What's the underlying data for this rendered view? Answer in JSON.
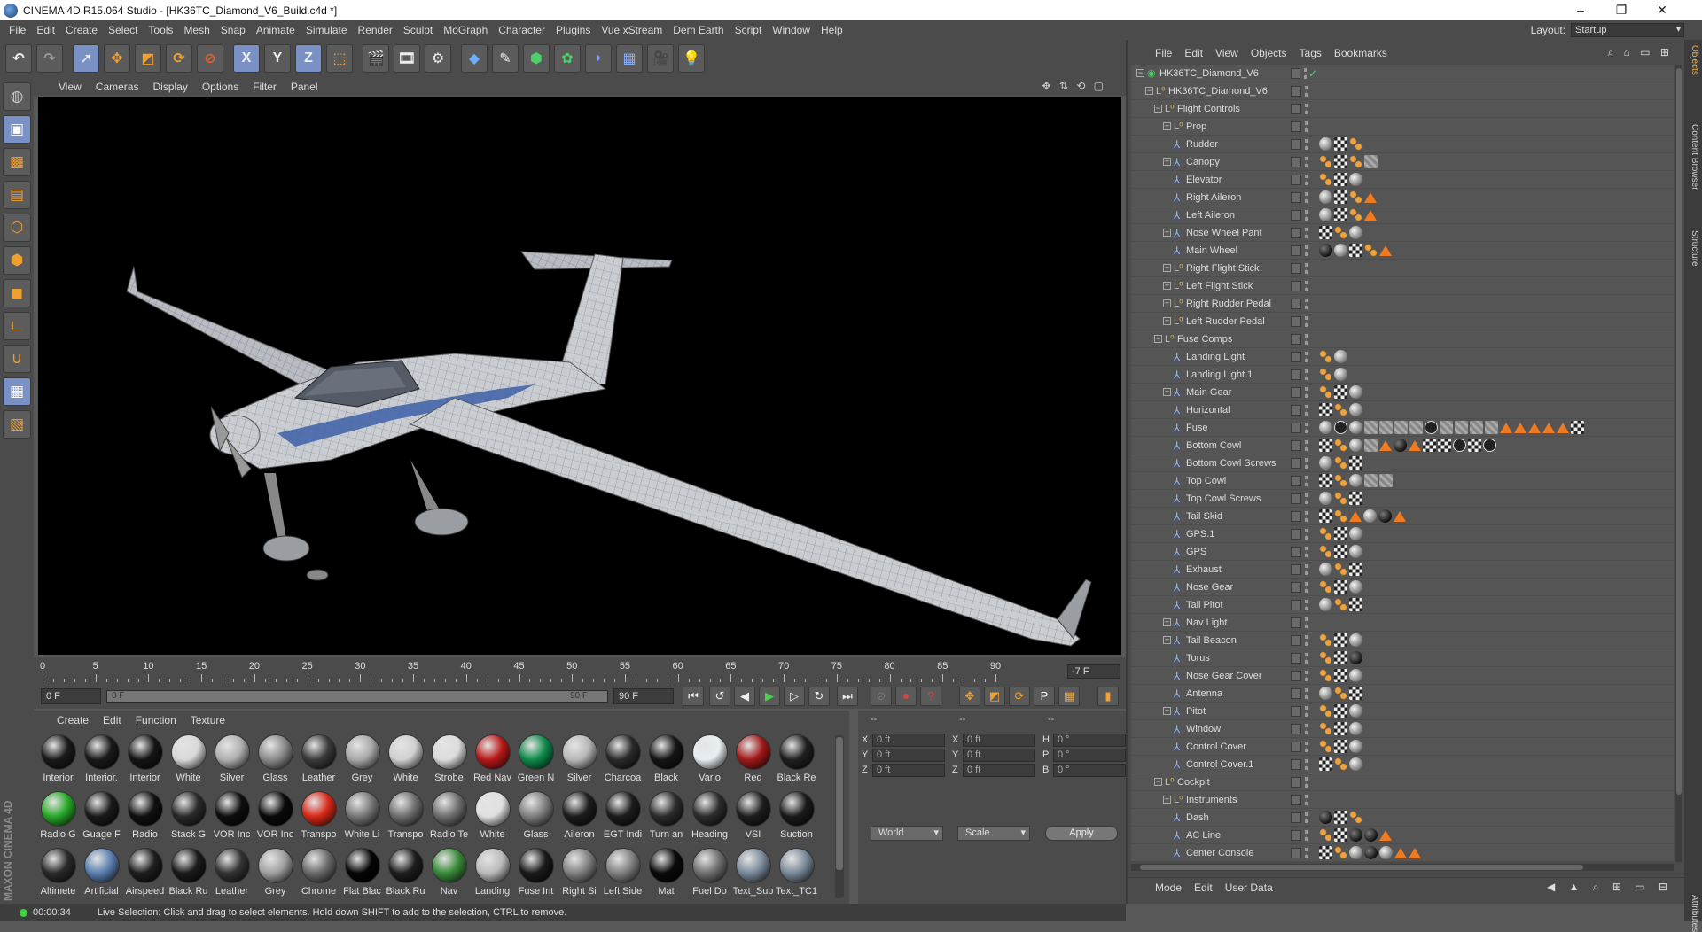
{
  "window": {
    "title": "CINEMA 4D R15.064 Studio - [HK36TC_Diamond_V6_Build.c4d *]",
    "minimize": "–",
    "maximize": "❐",
    "close": "✕"
  },
  "menubar": [
    "File",
    "Edit",
    "Create",
    "Select",
    "Tools",
    "Mesh",
    "Snap",
    "Animate",
    "Simulate",
    "Render",
    "Sculpt",
    "MoGraph",
    "Character",
    "Plugins",
    "Vue xStream",
    "Dem Earth",
    "Script",
    "Window",
    "Help"
  ],
  "layout": {
    "label": "Layout:",
    "value": "Startup"
  },
  "toolbar_axis": {
    "x": "X",
    "y": "Y",
    "z": "Z"
  },
  "viewport_menu": [
    "View",
    "Cameras",
    "Display",
    "Options",
    "Filter",
    "Panel"
  ],
  "timeline": {
    "ticks": [
      "0",
      "5",
      "10",
      "15",
      "20",
      "25",
      "30",
      "35",
      "40",
      "45",
      "50",
      "55",
      "60",
      "65",
      "70",
      "75",
      "80",
      "85",
      "90"
    ],
    "current_frame": "-7 F"
  },
  "transport": {
    "start": "0 F",
    "range_start": "0 F",
    "range_end": "90 F",
    "end": "90 F"
  },
  "materials": {
    "menu": [
      "Create",
      "Edit",
      "Function",
      "Texture"
    ],
    "items": [
      {
        "label": "Interior",
        "color": "#1a1a1a"
      },
      {
        "label": "Interior.",
        "color": "#1a1a1a"
      },
      {
        "label": "Interior",
        "color": "#151515"
      },
      {
        "label": "White",
        "color": "#d8d8d8"
      },
      {
        "label": "Silver",
        "color": "#b0b0b0"
      },
      {
        "label": "Glass",
        "color": "#8a8a8a"
      },
      {
        "label": "Leather",
        "color": "#3a3a3a"
      },
      {
        "label": "Grey",
        "color": "#a8a8a8"
      },
      {
        "label": "White",
        "color": "#d0d0d0"
      },
      {
        "label": "Strobe",
        "color": "#dcdcdc"
      },
      {
        "label": "Red Nav",
        "color": "#b81818"
      },
      {
        "label": "Green N",
        "color": "#0d8a4a"
      },
      {
        "label": "Silver",
        "color": "#b8b8b8"
      },
      {
        "label": "Charcoa",
        "color": "#2a2a2a"
      },
      {
        "label": "Black",
        "color": "#151515"
      },
      {
        "label": "Vario",
        "color": "#e8eef2"
      },
      {
        "label": "Red",
        "color": "#a01818"
      },
      {
        "label": "Black Re",
        "color": "#202020"
      },
      {
        "label": "Radio G",
        "color": "#28a828"
      },
      {
        "label": "Guage F",
        "color": "#1a1a1a"
      },
      {
        "label": "Radio",
        "color": "#101010"
      },
      {
        "label": "Stack G",
        "color": "#2a2a2a"
      },
      {
        "label": "VOR Inc",
        "color": "#0e0e0e"
      },
      {
        "label": "VOR Inc",
        "color": "#0a0a0a"
      },
      {
        "label": "Transpo",
        "color": "#d82818"
      },
      {
        "label": "White Li",
        "color": "#777777"
      },
      {
        "label": "Transpo",
        "color": "#6e6e6e"
      },
      {
        "label": "Radio Te",
        "color": "#6e6e6e"
      },
      {
        "label": "White",
        "color": "#e0e0e0"
      },
      {
        "label": "Glass",
        "color": "#7e7e7e"
      },
      {
        "label": "Aileron",
        "color": "#1c1c1c"
      },
      {
        "label": "EGT Indi",
        "color": "#1c1c1c"
      },
      {
        "label": "Turn an",
        "color": "#2c2c2c"
      },
      {
        "label": "Heading",
        "color": "#2c2c2c"
      },
      {
        "label": "VSI",
        "color": "#1e1e1e"
      },
      {
        "label": "Suction",
        "color": "#1a1a1a"
      },
      {
        "label": "Altimete",
        "color": "#2a2a2a"
      },
      {
        "label": "Artificial",
        "color": "#5a7fb0"
      },
      {
        "label": "Airspeed",
        "color": "#1e1e1e"
      },
      {
        "label": "Black Ru",
        "color": "#1a1a1a"
      },
      {
        "label": "Leather",
        "color": "#333333"
      },
      {
        "label": "Grey",
        "color": "#a0a0a0"
      },
      {
        "label": "Chrome",
        "color": "#6a6a6a"
      },
      {
        "label": "Flat Blac",
        "color": "#050505"
      },
      {
        "label": "Black Ru",
        "color": "#1e1e1e"
      },
      {
        "label": "Nav",
        "color": "#3a8a3a"
      },
      {
        "label": "Landing",
        "color": "#bbbbbb"
      },
      {
        "label": "Fuse Int",
        "color": "#1a1a1a"
      },
      {
        "label": "Right Si",
        "color": "#808080"
      },
      {
        "label": "Left Side",
        "color": "#808080"
      },
      {
        "label": "Mat",
        "color": "#0a0a0a"
      },
      {
        "label": "Fuel Do",
        "color": "#707070"
      },
      {
        "label": "Text_Sup",
        "color": "#7a8a9a"
      },
      {
        "label": "Text_TC1",
        "color": "#7a8a9a"
      }
    ]
  },
  "coordinates": {
    "headers": [
      "--",
      "--",
      "--"
    ],
    "rows": [
      {
        "a": "X",
        "av": "0 ft",
        "b": "X",
        "bv": "0 ft",
        "c": "H",
        "cv": "0 °"
      },
      {
        "a": "Y",
        "av": "0 ft",
        "b": "Y",
        "bv": "0 ft",
        "c": "P",
        "cv": "0 °"
      },
      {
        "a": "Z",
        "av": "0 ft",
        "b": "Z",
        "bv": "0 ft",
        "c": "B",
        "cv": "0 °"
      }
    ],
    "space": "World",
    "mode": "Scale",
    "apply": "Apply"
  },
  "status": {
    "time": "00:00:34",
    "message": "Live Selection: Click and drag to select elements. Hold down SHIFT to add to the selection, CTRL to remove."
  },
  "object_manager": {
    "menu": [
      "File",
      "Edit",
      "View",
      "Objects",
      "Tags",
      "Bookmarks"
    ],
    "objects": [
      {
        "name": "HK36TC_Diamond_V6",
        "depth": 0,
        "expand": "-",
        "icon": "scene",
        "tags": "k"
      },
      {
        "name": "HK36TC_Diamond_V6",
        "depth": 1,
        "expand": "-",
        "icon": "null",
        "tags": ""
      },
      {
        "name": "Flight Controls",
        "depth": 2,
        "expand": "-",
        "icon": "null",
        "tags": ""
      },
      {
        "name": "Prop",
        "depth": 3,
        "expand": "+",
        "icon": "null",
        "tags": ""
      },
      {
        "name": "Rudder",
        "depth": 3,
        "expand": "",
        "icon": "joint",
        "tags": "s c o"
      },
      {
        "name": "Canopy",
        "depth": 3,
        "expand": "+",
        "icon": "joint",
        "tags": "o c o h"
      },
      {
        "name": "Elevator",
        "depth": 3,
        "expand": "",
        "icon": "joint",
        "tags": "o c s"
      },
      {
        "name": "Right Aileron",
        "depth": 3,
        "expand": "",
        "icon": "joint",
        "tags": "s c o t"
      },
      {
        "name": "Left Aileron",
        "depth": 3,
        "expand": "",
        "icon": "joint",
        "tags": "s c o t"
      },
      {
        "name": "Nose Wheel Pant",
        "depth": 3,
        "expand": "+",
        "icon": "joint",
        "tags": "c o s"
      },
      {
        "name": "Main Wheel",
        "depth": 3,
        "expand": "",
        "icon": "joint",
        "tags": "d s c o t"
      },
      {
        "name": "Right Flight Stick",
        "depth": 3,
        "expand": "+",
        "icon": "null",
        "tags": ""
      },
      {
        "name": "Left Flight Stick",
        "depth": 3,
        "expand": "+",
        "icon": "null",
        "tags": ""
      },
      {
        "name": "Right Rudder Pedal",
        "depth": 3,
        "expand": "+",
        "icon": "null",
        "tags": ""
      },
      {
        "name": "Left Rudder Pedal",
        "depth": 3,
        "expand": "+",
        "icon": "null",
        "tags": ""
      },
      {
        "name": "Fuse Comps",
        "depth": 2,
        "expand": "-",
        "icon": "null",
        "tags": ""
      },
      {
        "name": "Landing Light",
        "depth": 3,
        "expand": "",
        "icon": "joint",
        "tags": "o s"
      },
      {
        "name": "Landing Light.1",
        "depth": 3,
        "expand": "",
        "icon": "joint",
        "tags": "o s"
      },
      {
        "name": "Main Gear",
        "depth": 3,
        "expand": "+",
        "icon": "joint",
        "tags": "o c s"
      },
      {
        "name": "Horizontal",
        "depth": 3,
        "expand": "",
        "icon": "joint",
        "tags": "c o s"
      },
      {
        "name": "Fuse",
        "depth": 3,
        "expand": "",
        "icon": "joint",
        "tags": "s m s h h h h m h h h h t t t t t c"
      },
      {
        "name": "Bottom Cowl",
        "depth": 3,
        "expand": "",
        "icon": "joint",
        "tags": "c o s h t d t c c m c m"
      },
      {
        "name": "Bottom Cowl Screws",
        "depth": 3,
        "expand": "",
        "icon": "joint",
        "tags": "s o c"
      },
      {
        "name": "Top Cowl",
        "depth": 3,
        "expand": "",
        "icon": "joint",
        "tags": "c o s h h"
      },
      {
        "name": "Top Cowl Screws",
        "depth": 3,
        "expand": "",
        "icon": "joint",
        "tags": "s o c"
      },
      {
        "name": "Tail Skid",
        "depth": 3,
        "expand": "",
        "icon": "joint",
        "tags": "c o t s d t"
      },
      {
        "name": "GPS.1",
        "depth": 3,
        "expand": "",
        "icon": "joint",
        "tags": "o c s"
      },
      {
        "name": "GPS",
        "depth": 3,
        "expand": "",
        "icon": "joint",
        "tags": "o c s"
      },
      {
        "name": "Exhaust",
        "depth": 3,
        "expand": "",
        "icon": "joint",
        "tags": "s o c"
      },
      {
        "name": "Nose Gear",
        "depth": 3,
        "expand": "",
        "icon": "joint",
        "tags": "o c s"
      },
      {
        "name": "Tail Pitot",
        "depth": 3,
        "expand": "",
        "icon": "joint",
        "tags": "s o c"
      },
      {
        "name": "Nav Light",
        "depth": 3,
        "expand": "+",
        "icon": "joint",
        "tags": ""
      },
      {
        "name": "Tail Beacon",
        "depth": 3,
        "expand": "+",
        "icon": "joint",
        "tags": "o c s"
      },
      {
        "name": "Torus",
        "depth": 3,
        "expand": "",
        "icon": "joint",
        "tags": "o c d"
      },
      {
        "name": "Nose Gear Cover",
        "depth": 3,
        "expand": "",
        "icon": "joint",
        "tags": "o c s"
      },
      {
        "name": "Antenna",
        "depth": 3,
        "expand": "",
        "icon": "joint",
        "tags": "s o c"
      },
      {
        "name": "Pitot",
        "depth": 3,
        "expand": "+",
        "icon": "joint",
        "tags": "o c s"
      },
      {
        "name": "Window",
        "depth": 3,
        "expand": "",
        "icon": "joint",
        "tags": "o c s"
      },
      {
        "name": "Control Cover",
        "depth": 3,
        "expand": "",
        "icon": "joint",
        "tags": "o c s"
      },
      {
        "name": "Control Cover.1",
        "depth": 3,
        "expand": "",
        "icon": "joint",
        "tags": "c o s"
      },
      {
        "name": "Cockpit",
        "depth": 2,
        "expand": "-",
        "icon": "null",
        "tags": ""
      },
      {
        "name": "Instruments",
        "depth": 3,
        "expand": "+",
        "icon": "null",
        "tags": ""
      },
      {
        "name": "Dash",
        "depth": 3,
        "expand": "",
        "icon": "joint",
        "tags": "d c o"
      },
      {
        "name": "AC Line",
        "depth": 3,
        "expand": "",
        "icon": "joint",
        "tags": "o c d d t"
      },
      {
        "name": "Center Console",
        "depth": 3,
        "expand": "",
        "icon": "joint",
        "tags": "c o s d s t t"
      }
    ]
  },
  "attributes_menu": [
    "Mode",
    "Edit",
    "User Data"
  ],
  "side_tabs": [
    "Objects",
    "Content Browser",
    "Structure",
    "Attributes"
  ],
  "colors": {
    "accent": "#7991c4",
    "panel": "#4b4b4b",
    "dark": "#3d3d3d",
    "tag_orange": "#f07a20",
    "play": "#4ad24a"
  }
}
